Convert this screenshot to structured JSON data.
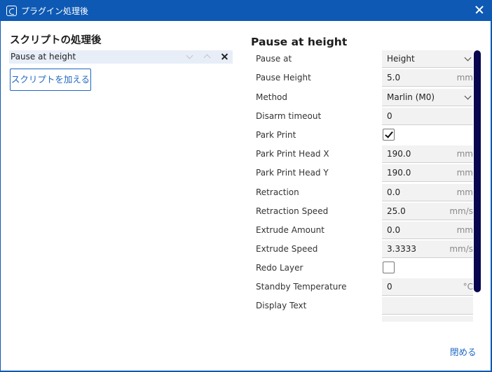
{
  "window": {
    "title": "プラグイン処理後",
    "icon": "cura-icon"
  },
  "left_panel": {
    "title": "スクリプトの処理後",
    "scripts": [
      {
        "label": "Pause at height"
      }
    ],
    "add_button_label": "スクリプトを加える"
  },
  "right_panel": {
    "title": "Pause at height",
    "settings": [
      {
        "label": "Pause at",
        "type": "dropdown",
        "value": "Height"
      },
      {
        "label": "Pause Height",
        "type": "number",
        "value": "5.0",
        "unit": "mm"
      },
      {
        "label": "Method",
        "type": "dropdown",
        "value": "Marlin (M0)"
      },
      {
        "label": "Disarm timeout",
        "type": "number",
        "value": "0",
        "unit": ""
      },
      {
        "label": "Park Print",
        "type": "checkbox",
        "checked": true
      },
      {
        "label": "Park Print Head X",
        "type": "number",
        "value": "190.0",
        "unit": "mm"
      },
      {
        "label": "Park Print Head Y",
        "type": "number",
        "value": "190.0",
        "unit": "mm"
      },
      {
        "label": "Retraction",
        "type": "number",
        "value": "0.0",
        "unit": "mm"
      },
      {
        "label": "Retraction Speed",
        "type": "number",
        "value": "25.0",
        "unit": "mm/s"
      },
      {
        "label": "Extrude Amount",
        "type": "number",
        "value": "0.0",
        "unit": "mm"
      },
      {
        "label": "Extrude Speed",
        "type": "number",
        "value": "3.3333",
        "unit": "mm/s"
      },
      {
        "label": "Redo Layer",
        "type": "checkbox",
        "checked": false
      },
      {
        "label": "Standby Temperature",
        "type": "number",
        "value": "0",
        "unit": "°C"
      },
      {
        "label": "Display Text",
        "type": "text",
        "value": ""
      },
      {
        "label": "",
        "type": "text",
        "value": ""
      }
    ]
  },
  "footer": {
    "close_label": "閉める"
  },
  "colors": {
    "title_bar": "#0d59b4",
    "accent": "#1e66c2",
    "scrollbar": "#07064f",
    "selected_item": "#e8eef8"
  }
}
